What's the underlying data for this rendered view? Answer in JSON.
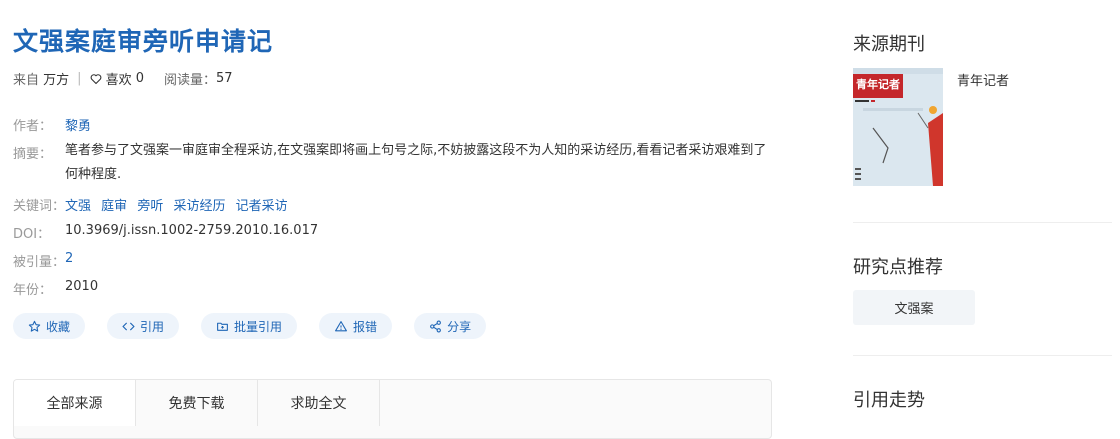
{
  "article": {
    "title": "文强案庭审旁听申请记",
    "source_label": "来自",
    "source_value": "万方",
    "likes_label": "喜欢",
    "likes_count": "0",
    "reads_label": "阅读量：",
    "reads_count": "57"
  },
  "fields": {
    "author_label": "作者：",
    "author": "黎勇",
    "abstract_label": "摘要：",
    "abstract": "笔者参与了文强案一审庭审全程采访,在文强案即将画上句号之际,不妨披露这段不为人知的采访经历,看看记者采访艰难到了何种程度.",
    "keywords_label": "关键词：",
    "keywords": [
      "文强",
      "庭审",
      "旁听",
      "采访经历",
      "记者采访"
    ],
    "doi_label": "DOI：",
    "doi": "10.3969/j.issn.1002-2759.2010.16.017",
    "cited_label": "被引量：",
    "cited": "2",
    "year_label": "年份：",
    "year": "2010"
  },
  "actions": {
    "collect": "收藏",
    "cite": "引用",
    "batch_cite": "批量引用",
    "report": "报错",
    "share": "分享"
  },
  "tabs": [
    "全部来源",
    "免费下载",
    "求助全文"
  ],
  "sidebar": {
    "source_journal_title": "来源期刊",
    "journal_name": "青年记者",
    "cover_text": "青年记者",
    "research_title": "研究点推荐",
    "research_tag": "文强案",
    "trend_title": "引用走势"
  },
  "colors": {
    "accent": "#1f66b6",
    "button_bg": "#eef4fb",
    "tag_bg": "#f2f5f8"
  }
}
